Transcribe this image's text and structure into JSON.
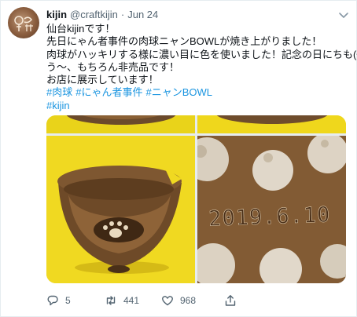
{
  "author": {
    "name": "kijin",
    "handle": "@craftkijin",
    "separator": "·",
    "date": "Jun 24",
    "avatar_mark": "kijin"
  },
  "tweet": {
    "lines": [
      "仙台kijinです！",
      "先日にゃん者事件の肉球ニャンBOWLが焼き上がりました！",
      "肉球がハッキリする様に濃い目に色を使いました！記念の日にちも(^ ^)",
      "う〜、もちろん非売品です！",
      "お店に展示しています！"
    ],
    "hashtags_line1": [
      "#肉球",
      "#にゃん者事件",
      "#ニャンBOWL"
    ],
    "hashtags_line2": [
      "#kijin"
    ]
  },
  "media": {
    "photo_text": "2019.6.10"
  },
  "actions": {
    "replies": "5",
    "retweets": "441",
    "likes": "968"
  },
  "icons": {
    "more": "chevron-down-icon",
    "reply": "reply-icon",
    "retweet": "retweet-icon",
    "like": "heart-icon",
    "share": "share-icon"
  },
  "colors": {
    "link": "#1b95e0",
    "muted": "#536471",
    "text": "#0f1419"
  }
}
